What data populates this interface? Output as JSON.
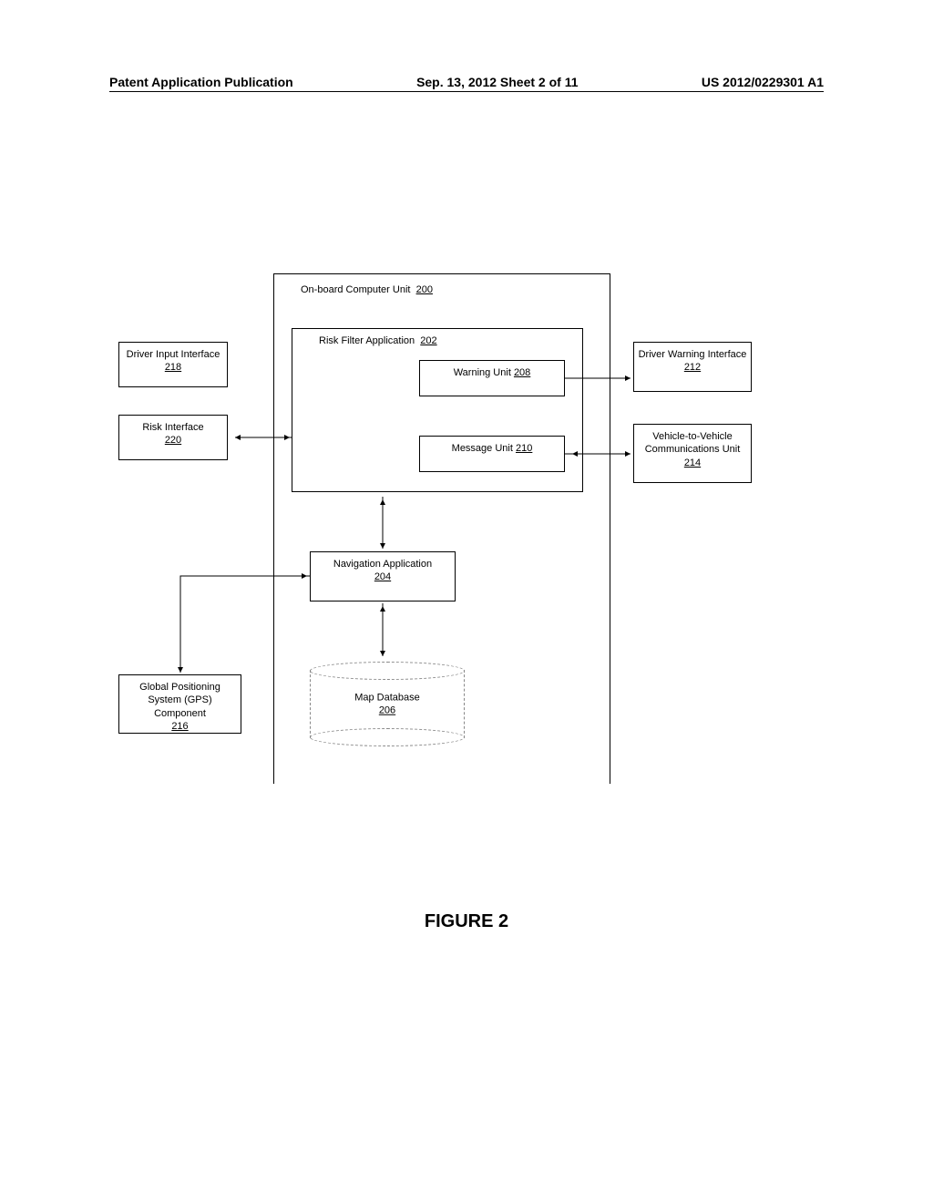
{
  "header": {
    "left": "Patent Application Publication",
    "center": "Sep. 13, 2012   Sheet 2 of 11",
    "right": "US 2012/0229301 A1"
  },
  "blocks": {
    "onboard": {
      "title": "On-board Computer Unit",
      "ref": "200"
    },
    "riskfilter": {
      "title": "Risk Filter Application",
      "ref": "202"
    },
    "warning": {
      "title": "Warning Unit",
      "ref": "208"
    },
    "message": {
      "title": "Message Unit",
      "ref": "210"
    },
    "nav": {
      "title": "Navigation Application",
      "ref": "204"
    },
    "mapdb": {
      "title": "Map Database",
      "ref": "206"
    },
    "driverinput": {
      "title": "Driver Input Interface",
      "ref": "218"
    },
    "riskif": {
      "title": "Risk Interface",
      "ref": "220"
    },
    "driverwarn": {
      "title": "Driver Warning Interface",
      "ref": "212"
    },
    "v2v": {
      "title": "Vehicle-to-Vehicle Communications Unit",
      "ref": "214"
    },
    "gps": {
      "title": "Global Positioning System (GPS) Component",
      "ref": "216"
    }
  },
  "caption": "FIGURE 2"
}
